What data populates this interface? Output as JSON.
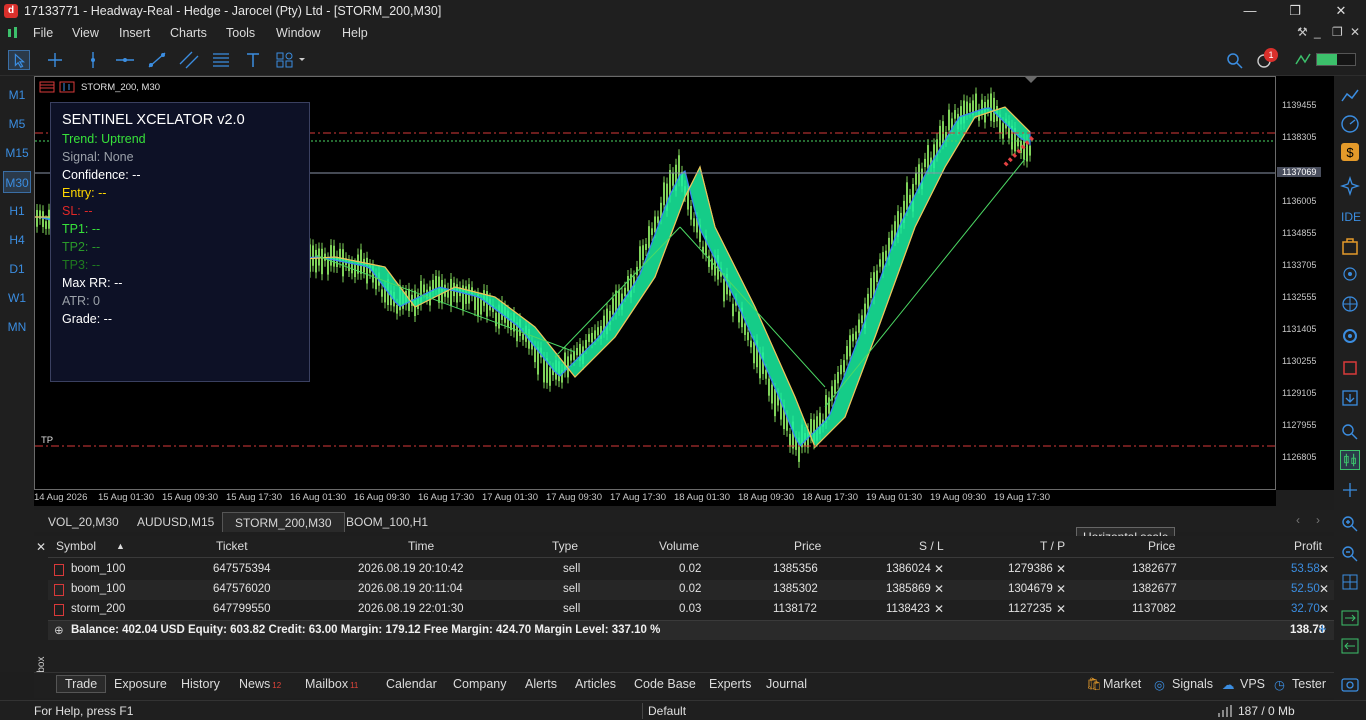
{
  "window": {
    "logo": "d",
    "title": "17133771 - Headway-Real - Hedge - Jarocel (Pty) Ltd - [STORM_200,M30]",
    "minimize": "—",
    "restore": "❐",
    "close": "✕"
  },
  "menu": [
    "File",
    "View",
    "Insert",
    "Charts",
    "Tools",
    "Window",
    "Help"
  ],
  "timeframes": [
    "M1",
    "M5",
    "M15",
    "M30",
    "H1",
    "H4",
    "D1",
    "W1",
    "MN"
  ],
  "active_timeframe": "M30",
  "chart": {
    "label": "STORM_200, M30",
    "tp_label": "TP",
    "current_price": "1137069",
    "price_ticks": [
      "1139455",
      "1138305",
      "1137069",
      "1136005",
      "1134855",
      "1133705",
      "1132555",
      "1131405",
      "1130255",
      "1129105",
      "1127955",
      "1126805"
    ],
    "time_ticks": [
      "14 Aug 2026",
      "15 Aug 01:30",
      "15 Aug 09:30",
      "15 Aug 17:30",
      "16 Aug 01:30",
      "16 Aug 09:30",
      "16 Aug 17:30",
      "17 Aug 01:30",
      "17 Aug 09:30",
      "17 Aug 17:30",
      "18 Aug 01:30",
      "18 Aug 09:30",
      "18 Aug 17:30",
      "19 Aug 01:30",
      "19 Aug 09:30",
      "19 Aug 17:30"
    ],
    "colors": {
      "candle": "#7fd35a",
      "ribbon": "#19f0a0",
      "ribbon_edge": "#3b82f6",
      "level_red": "#d83a3a",
      "level_green": "#4cd964"
    }
  },
  "indicator_panel": {
    "title": "SENTINEL XCELATOR v2.0",
    "trend": "Trend: Uptrend",
    "signal": "Signal: None",
    "confidence": "Confidence: --",
    "entry": "Entry: --",
    "sl": "SL: --",
    "tp1": "TP1: --",
    "tp2": "TP2: --",
    "tp3": "TP3: --",
    "max_rr": "Max RR: --",
    "atr": "ATR: 0",
    "grade": "Grade: --"
  },
  "chart_tabs": [
    "VOL_20,M30",
    "AUDUSD,M15",
    "STORM_200,M30",
    "BOOM_100,H1"
  ],
  "active_chart_tab": "STORM_200,M30",
  "tooltip": "Horizontal scale",
  "trade_table": {
    "headers": [
      "Symbol",
      "Ticket",
      "Time",
      "Type",
      "Volume",
      "Price",
      "S / L",
      "T / P",
      "Price",
      "Profit"
    ],
    "rows": [
      {
        "symbol": "boom_100",
        "ticket": "647575394",
        "time": "2026.08.19 20:10:42",
        "type": "sell",
        "volume": "0.02",
        "price": "1385356",
        "sl": "1386024",
        "tp": "1279386",
        "cur": "1382677",
        "profit": "53.58"
      },
      {
        "symbol": "boom_100",
        "ticket": "647576020",
        "time": "2026.08.19 20:11:04",
        "type": "sell",
        "volume": "0.02",
        "price": "1385302",
        "sl": "1385869",
        "tp": "1304679",
        "cur": "1382677",
        "profit": "52.50"
      },
      {
        "symbol": "storm_200",
        "ticket": "647799550",
        "time": "2026.08.19 22:01:30",
        "type": "sell",
        "volume": "0.03",
        "price": "1138172",
        "sl": "1138423",
        "tp": "1127235",
        "cur": "1137082",
        "profit": "32.70"
      }
    ],
    "balance_line": "Balance: 402.04 USD  Equity: 603.82  Credit: 63.00  Margin: 179.12  Free Margin: 424.70  Margin Level: 337.10 %",
    "total_profit": "138.78"
  },
  "toolbox_label": "Toolbox",
  "bottom_tabs": [
    {
      "label": "Trade",
      "badge": ""
    },
    {
      "label": "Exposure",
      "badge": ""
    },
    {
      "label": "History",
      "badge": ""
    },
    {
      "label": "News",
      "badge": "12"
    },
    {
      "label": "Mailbox",
      "badge": "11"
    },
    {
      "label": "Calendar",
      "badge": ""
    },
    {
      "label": "Company",
      "badge": ""
    },
    {
      "label": "Alerts",
      "badge": ""
    },
    {
      "label": "Articles",
      "badge": ""
    },
    {
      "label": "Code Base",
      "badge": ""
    },
    {
      "label": "Experts",
      "badge": ""
    },
    {
      "label": "Journal",
      "badge": ""
    }
  ],
  "bottom_right": {
    "market": "Market",
    "signals": "Signals",
    "vps": "VPS",
    "tester": "Tester"
  },
  "status": {
    "help": "For Help, press F1",
    "profile": "Default",
    "traffic": "187 / 0 Mb"
  },
  "ide_label": "IDE",
  "notification_count": "1"
}
